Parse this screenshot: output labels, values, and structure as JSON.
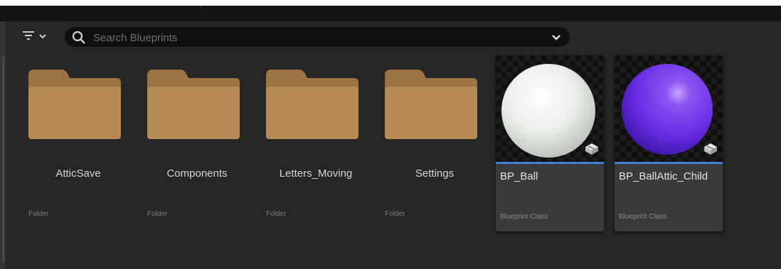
{
  "search": {
    "placeholder": "Search Blueprints",
    "value": ""
  },
  "items": [
    {
      "name": "AtticSave",
      "type": "Folder",
      "kind": "folder"
    },
    {
      "name": "Components",
      "type": "Folder",
      "kind": "folder"
    },
    {
      "name": "Letters_Moving",
      "type": "Folder",
      "kind": "folder"
    },
    {
      "name": "Settings",
      "type": "Folder",
      "kind": "folder"
    },
    {
      "name": "BP_Ball",
      "type": "Blueprint Class",
      "kind": "blueprint"
    },
    {
      "name": "BP_BallAttic_Child",
      "type": "Blueprint Class",
      "kind": "blueprint"
    }
  ],
  "colors": {
    "folder": "#b58a55",
    "accent": "#3f7fd8",
    "ball_white": "#e9ede7",
    "ball_purple": "#6a2ee6"
  },
  "icons": {
    "filter": "filter-icon",
    "search": "search-icon",
    "dropdown": "chevron-down-icon",
    "blueprint_badge": "blueprint-class-icon"
  }
}
